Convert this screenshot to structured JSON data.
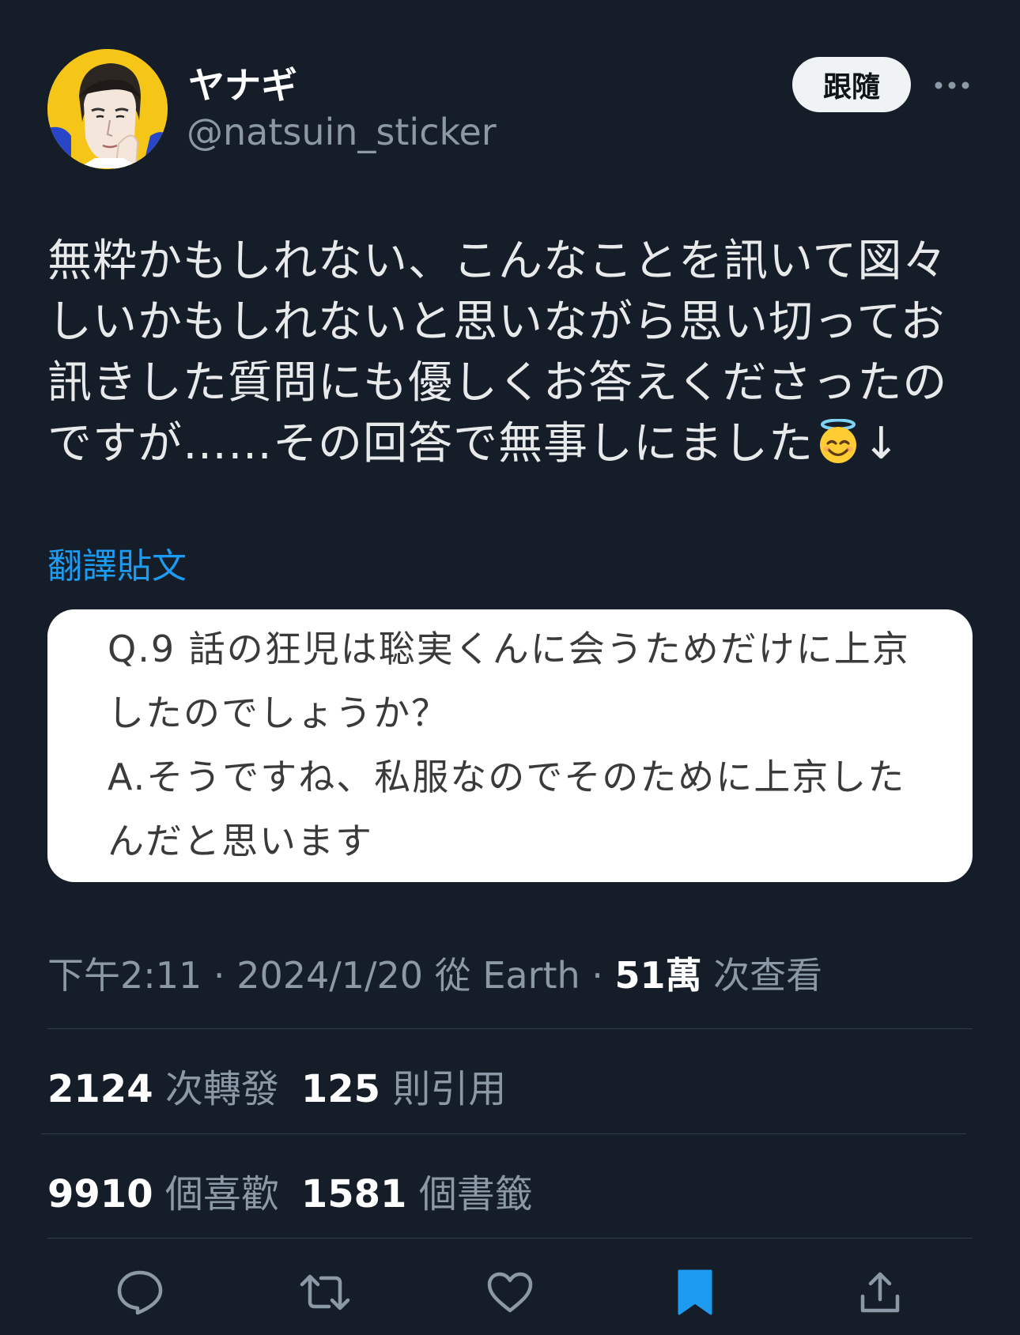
{
  "user": {
    "display_name": "ヤナギ",
    "handle": "@natsuin_sticker"
  },
  "follow_label": "跟隨",
  "tweet": {
    "text_before_emoji": "無粋かもしれない、こんなことを訊いて図々しいかもしれないと思いながら思い切ってお訊きした質問にも優しくお答えくださったのですが……その回答で無事しにました",
    "emoji": "smiling-face-with-halo",
    "text_after_emoji": "↓"
  },
  "translate_label": "翻譯貼文",
  "image_card": {
    "text": "Q.9 話の狂児は聡実くんに会うためだけに上京したのでしょうか？\nA.そうですね、私服なのでそのために上京したんだと思います"
  },
  "meta": {
    "time": "下午2:11",
    "sep1": " · ",
    "date": "2024/1/20",
    "from_word": " 從 ",
    "source": "Earth",
    "sep2": " · ",
    "views_count": "51萬",
    "views_label": " 次查看"
  },
  "stats": {
    "retweets": {
      "count": "2124",
      "label": " 次轉發"
    },
    "quotes": {
      "count": "125",
      "label": " 則引用"
    },
    "likes": {
      "count": "9910",
      "label": " 個喜歡"
    },
    "bookmarks": {
      "count": "1581",
      "label": " 個書籤"
    }
  },
  "actions": {
    "icons": [
      "reply-icon",
      "retweet-icon",
      "like-icon",
      "bookmark-icon",
      "share-icon"
    ],
    "bookmark_active_color": "#1d9bf0",
    "icon_color": "#8b98a5"
  }
}
